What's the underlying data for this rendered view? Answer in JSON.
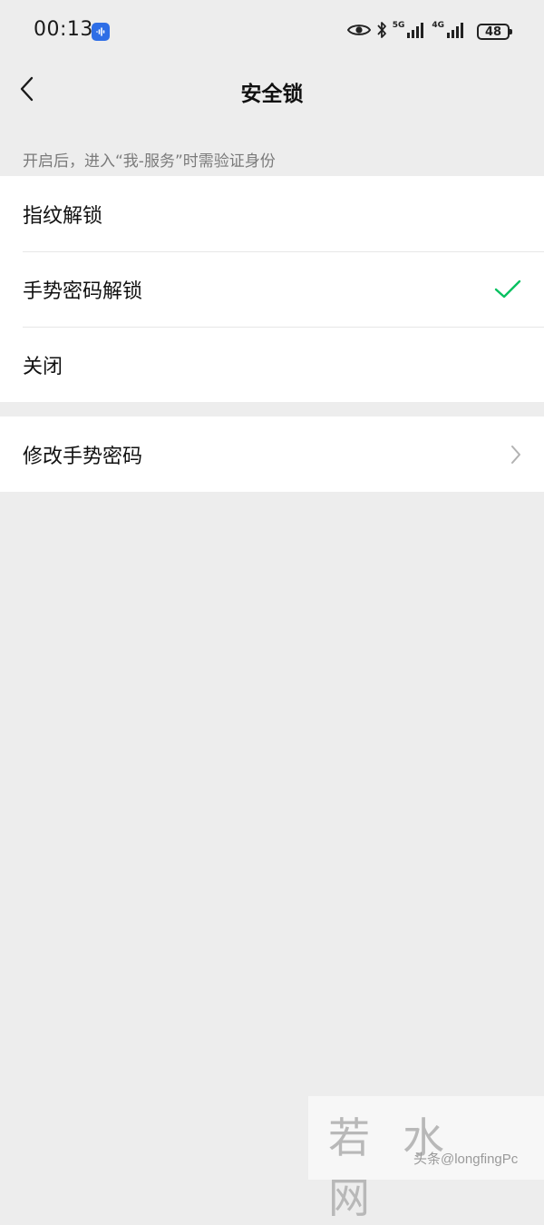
{
  "status_bar": {
    "time": "00:13",
    "network_1": "5G",
    "network_2": "4G",
    "battery": "48",
    "icons": [
      "recorder-app-icon",
      "eye-icon",
      "bluetooth-icon",
      "signal-icon",
      "signal-icon",
      "battery-icon"
    ]
  },
  "nav": {
    "title": "安全锁",
    "back_icon": "chevron-left-icon"
  },
  "hint": "开启后，进入“我-服务”时需验证身份",
  "lock_options": [
    {
      "label": "指纹解锁",
      "selected": false
    },
    {
      "label": "手势密码解锁",
      "selected": true
    },
    {
      "label": "关闭",
      "selected": false
    }
  ],
  "settings": {
    "change_gesture_label": "修改手势密码",
    "chevron_icon": "chevron-right-icon"
  },
  "watermark": {
    "brand": "若水网",
    "credit": "头条@longfingPc"
  },
  "colors": {
    "background": "#ededed",
    "check": "#07c160",
    "badge": "#2e6ee6"
  }
}
